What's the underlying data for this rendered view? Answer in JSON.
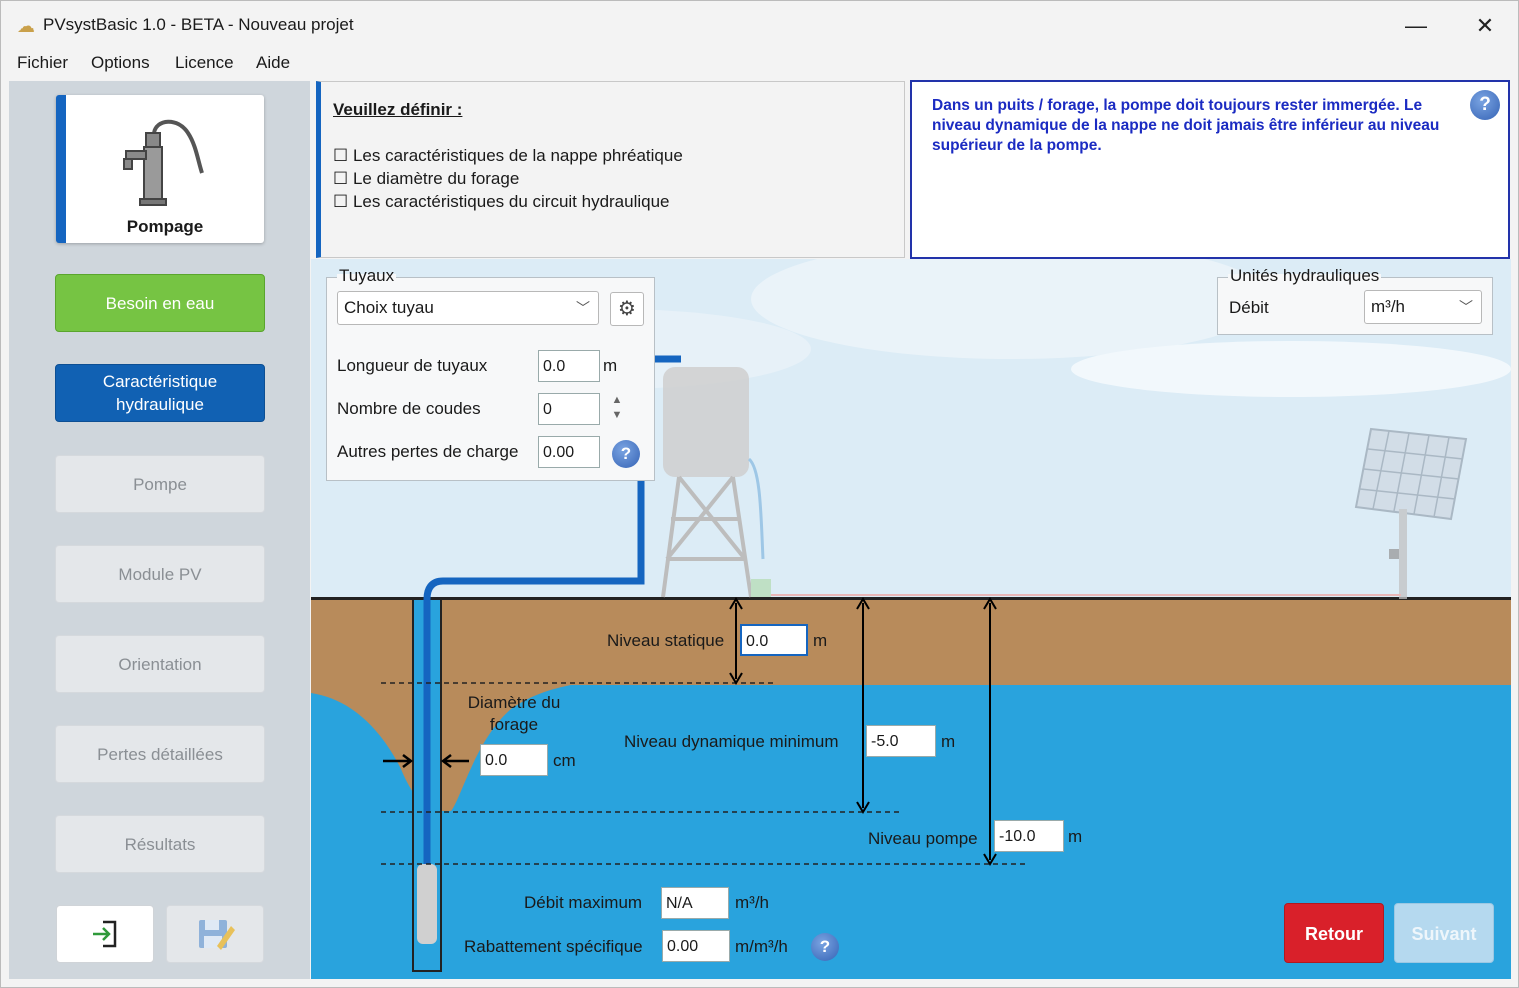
{
  "window": {
    "title": "PVsystBasic 1.0 - BETA - Nouveau projet",
    "minimize": "—",
    "close": "✕"
  },
  "menu": [
    "Fichier",
    "Options",
    "Licence",
    "Aide"
  ],
  "sidebar": {
    "current": "Pompage",
    "steps": [
      {
        "label": "Besoin en eau",
        "state": "done"
      },
      {
        "label": "Caractéristique hydraulique",
        "state": "active"
      },
      {
        "label": "Pompe",
        "state": "disabled"
      },
      {
        "label": "Module PV",
        "state": "disabled"
      },
      {
        "label": "Orientation",
        "state": "disabled"
      },
      {
        "label": "Pertes détaillées",
        "state": "disabled"
      },
      {
        "label": "Résultats",
        "state": "disabled"
      }
    ],
    "icons": [
      "exit-icon",
      "save-icon"
    ]
  },
  "instructions": {
    "heading": "Veuillez définir :",
    "items": [
      "☐ Les caractéristiques de la nappe phréatique",
      "☐ Le diamètre du forage",
      "☐ Les caractéristiques du circuit hydraulique"
    ]
  },
  "info": {
    "text": "Dans un puits / forage, la pompe doit toujours rester immergée. Le niveau dynamique de la nappe ne doit jamais être inférieur au niveau supérieur de la pompe."
  },
  "tuyaux": {
    "title": "Tuyaux",
    "pipe_choice": "Choix tuyau",
    "length_label": "Longueur de tuyaux",
    "length_value": "0.0",
    "length_unit": "m",
    "elbows_label": "Nombre de coudes",
    "elbows_value": "0",
    "other_losses_label": "Autres pertes de charge",
    "other_losses_value": "0.00"
  },
  "units": {
    "title": "Unités hydrauliques",
    "flow_label": "Débit",
    "flow_unit": "m³/h"
  },
  "well": {
    "static_label": "Niveau statique",
    "static_value": "0.0",
    "static_unit": "m",
    "diameter_label_1": "Diamètre du",
    "diameter_label_2": "forage",
    "diameter_value": "0.0",
    "diameter_unit": "cm",
    "dynamic_label": "Niveau dynamique minimum",
    "dynamic_value": "-5.0",
    "dynamic_unit": "m",
    "pump_level_label": "Niveau pompe",
    "pump_level_value": "-10.0",
    "pump_level_unit": "m",
    "max_flow_label": "Débit maximum",
    "max_flow_value": "N/A",
    "max_flow_unit": "m³/h",
    "drawdown_label": "Rabattement spécifique",
    "drawdown_value": "0.00",
    "drawdown_unit": "m/m³/h"
  },
  "buttons": {
    "back": "Retour",
    "next": "Suivant"
  },
  "colors": {
    "primary_blue": "#1161b3",
    "green": "#76c443",
    "red": "#d9202a",
    "water": "#29a3dd",
    "soil": "#b88b5b",
    "sky": "#dcecf6"
  }
}
